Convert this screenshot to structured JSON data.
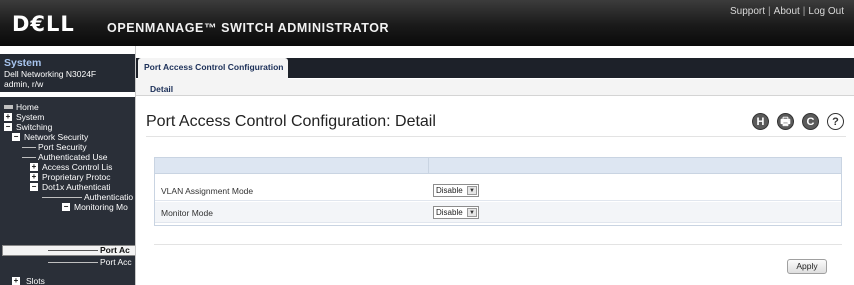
{
  "header": {
    "logo": "D€LL",
    "product": "OPENMANAGE™ SWITCH ADMINISTRATOR",
    "links": [
      "Support",
      "About",
      "Log Out"
    ]
  },
  "sidebar": {
    "system_title": "System",
    "system_device": "Dell Networking N3024F",
    "system_user": "admin, r/w",
    "nav": [
      {
        "label": "Home"
      },
      {
        "label": "System",
        "toggle": "+"
      },
      {
        "label": "Switching",
        "toggle": "−"
      },
      {
        "label": "Network Security",
        "toggle": "−"
      },
      {
        "label": "Port Security"
      },
      {
        "label": "Authenticated Use"
      },
      {
        "label": "Access Control Lis",
        "toggle": "+"
      },
      {
        "label": "Proprietary Protoc",
        "toggle": "+"
      },
      {
        "label": "Dot1x Authenticati",
        "toggle": "−"
      },
      {
        "label": "Authenticatio"
      },
      {
        "label": "Monitoring Mo",
        "toggle": "−"
      },
      {
        "label": "Port Ac"
      },
      {
        "label": "Port Acc"
      },
      {
        "label": "Slots",
        "toggle": "+"
      }
    ]
  },
  "tabs": {
    "active": "Port Access Control Configuration",
    "sub": "Detail"
  },
  "page": {
    "title": "Port Access Control Configuration: Detail",
    "icons": [
      "H",
      "🖶",
      "C",
      "?"
    ]
  },
  "form": {
    "rows": [
      {
        "label": "VLAN Assignment Mode",
        "value": "Disable"
      },
      {
        "label": "Monitor Mode",
        "value": "Disable"
      }
    ]
  },
  "apply_label": "Apply"
}
